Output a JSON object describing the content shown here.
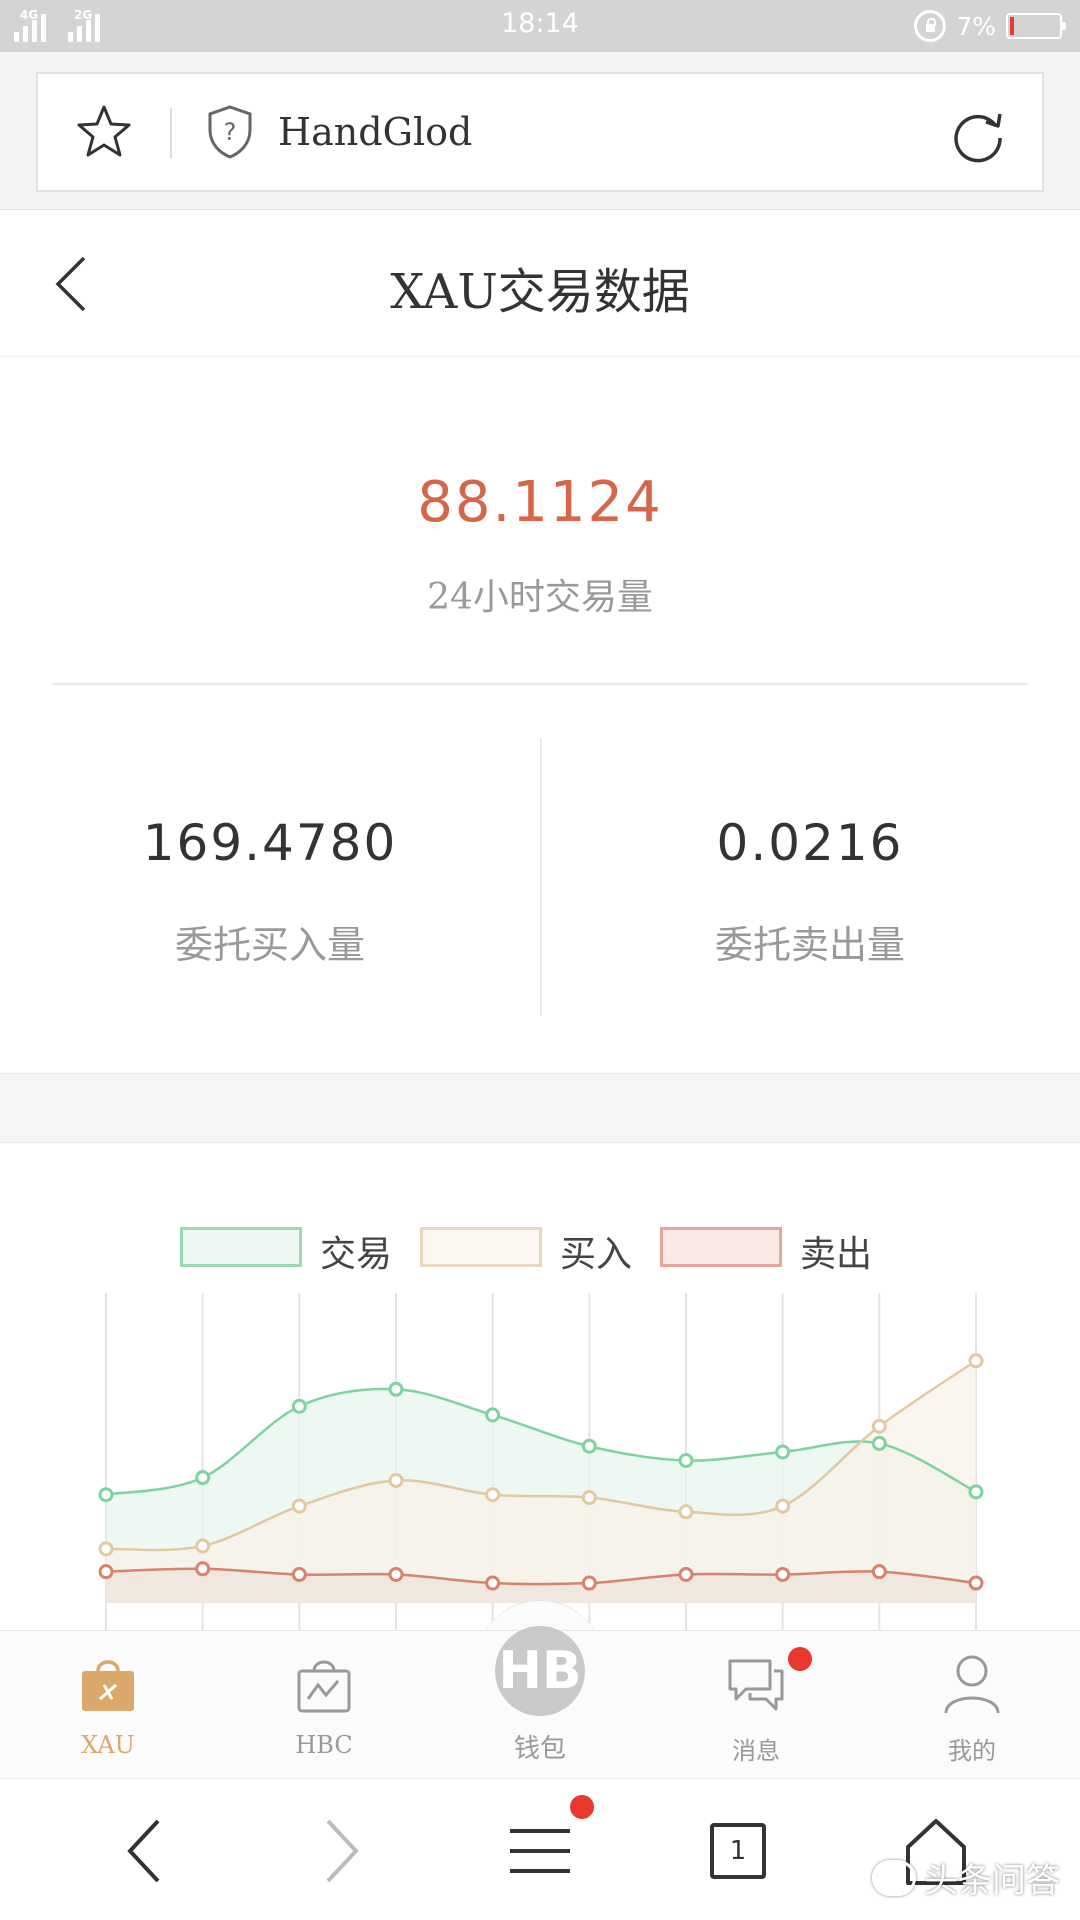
{
  "status_bar": {
    "network_1": "4G",
    "network_2": "2G",
    "time": "18:14",
    "battery_percent": "7%",
    "battery_level": 0.07,
    "battery_color": "#e83a2e"
  },
  "browser": {
    "site_name": "HandGlod",
    "icons": [
      "star-icon",
      "shield-question-icon",
      "reload-icon"
    ]
  },
  "header": {
    "title": "XAU交易数据",
    "back_icon": "chevron-left-icon"
  },
  "summary": {
    "volume_24h": "88.1124",
    "volume_24h_label": "24小时交易量",
    "buy_orders": "169.4780",
    "buy_orders_label": "委托买入量",
    "sell_orders": "0.0216",
    "sell_orders_label": "委托卖出量",
    "accent_color": "#d66648"
  },
  "chart_data": {
    "type": "area",
    "title": "",
    "xlabel": "",
    "ylabel": "",
    "grid": "vertical",
    "legend_placement": "top-center",
    "ylim": [
      0,
      100
    ],
    "series": [
      {
        "name": "交易",
        "color": "#7dd4a0",
        "fill": "#e8f6ee",
        "values": [
          38,
          44,
          69,
          75,
          66,
          55,
          50,
          53,
          56,
          39
        ]
      },
      {
        "name": "买入",
        "color": "#e2c9a0",
        "fill": "#f8f1e7",
        "values": [
          19,
          20,
          34,
          43,
          38,
          37,
          32,
          34,
          62,
          85
        ]
      },
      {
        "name": "卖出",
        "color": "#d9826a",
        "fill": "#efe7de",
        "values": [
          11,
          12,
          10,
          10,
          7,
          7,
          10,
          10,
          11,
          7
        ]
      }
    ]
  },
  "tab_bar": {
    "tabs": [
      {
        "label": "XAU",
        "icon": "shopping-bag-icon",
        "active": true
      },
      {
        "label": "HBC",
        "icon": "chart-bag-icon",
        "active": false
      },
      {
        "label": "钱包",
        "icon": "hb-coin-icon",
        "active": false
      },
      {
        "label": "消息",
        "icon": "chat-bubbles-icon",
        "active": false,
        "badge": true
      },
      {
        "label": "我的",
        "icon": "user-icon",
        "active": false
      }
    ],
    "wallet_glyph": "HB",
    "active_color": "#d9a86a",
    "badge_color": "#e8392c"
  },
  "nav_bar": {
    "tab_count": "1",
    "icons": [
      "back-arrow-icon",
      "forward-arrow-icon",
      "menu-icon",
      "tabs-icon",
      "home-icon"
    ]
  },
  "watermark": "头条问答"
}
